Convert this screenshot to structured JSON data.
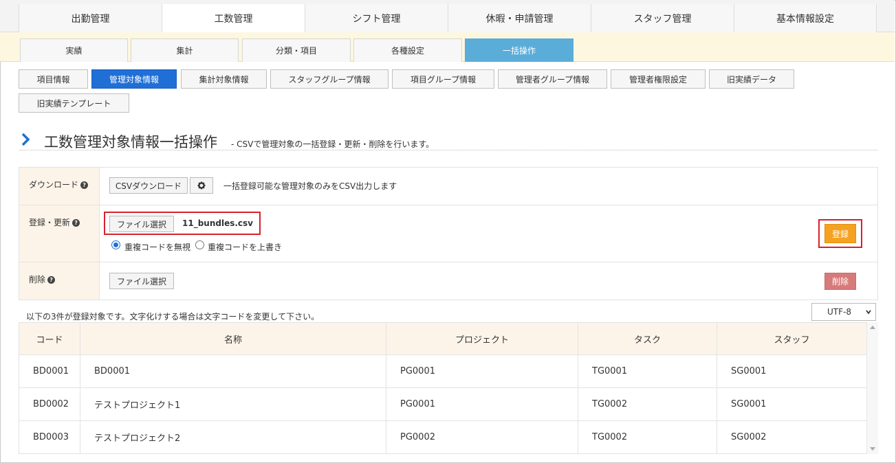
{
  "top_tabs": [
    "出勤管理",
    "工数管理",
    "シフト管理",
    "休暇・申請管理",
    "スタッフ管理",
    "基本情報設定"
  ],
  "top_active": 1,
  "sub_tabs": [
    "実績",
    "集計",
    "分類・項目",
    "各種設定",
    "一括操作"
  ],
  "sub_active": 4,
  "section_buttons": [
    "項目情報",
    "管理対象情報",
    "集計対象情報",
    "スタッフグループ情報",
    "項目グループ情報",
    "管理者グループ情報",
    "管理者権限設定",
    "旧実績データ",
    "旧実績テンプレート"
  ],
  "section_active": 1,
  "heading": {
    "title": "工数管理対象情報一括操作",
    "subtitle": "- CSVで管理対象の一括登録・更新・削除を行います。"
  },
  "download_row": {
    "label": "ダウンロード",
    "button": "CSVダウンロード",
    "gear_icon": "gear-icon",
    "note": "一括登録可能な管理対象のみをCSV出力します"
  },
  "register_row": {
    "label": "登録・更新",
    "file_button": "ファイル選択",
    "file_name": "11_bundles.csv",
    "radio_ignore": "重複コードを無視",
    "radio_overwrite": "重複コードを上書き",
    "submit": "登録"
  },
  "delete_row": {
    "label": "削除",
    "file_button": "ファイル選択",
    "submit": "削除"
  },
  "help_glyph": "?",
  "info_text": "以下の3件が登録対象です。文字化けする場合は文字コードを変更して下さい。",
  "encoding": "UTF-8",
  "table": {
    "headers": [
      "コード",
      "名称",
      "プロジェクト",
      "タスク",
      "スタッフ"
    ],
    "rows": [
      [
        "BD0001",
        "BD0001",
        "PG0001",
        "TG0001",
        "SG0001"
      ],
      [
        "BD0002",
        "テストプロジェクト1",
        "PG0001",
        "TG0002",
        "SG0001"
      ],
      [
        "BD0003",
        "テストプロジェクト2",
        "PG0002",
        "TG0002",
        "SG0002"
      ]
    ]
  },
  "colors": {
    "active_sub_tab": "#5aadd9",
    "active_button": "#1f6fd6",
    "register_button": "#f5a221",
    "delete_button": "#d77a7a",
    "highlight_box": "#d9202a",
    "label_bg": "#fdf4e9"
  }
}
